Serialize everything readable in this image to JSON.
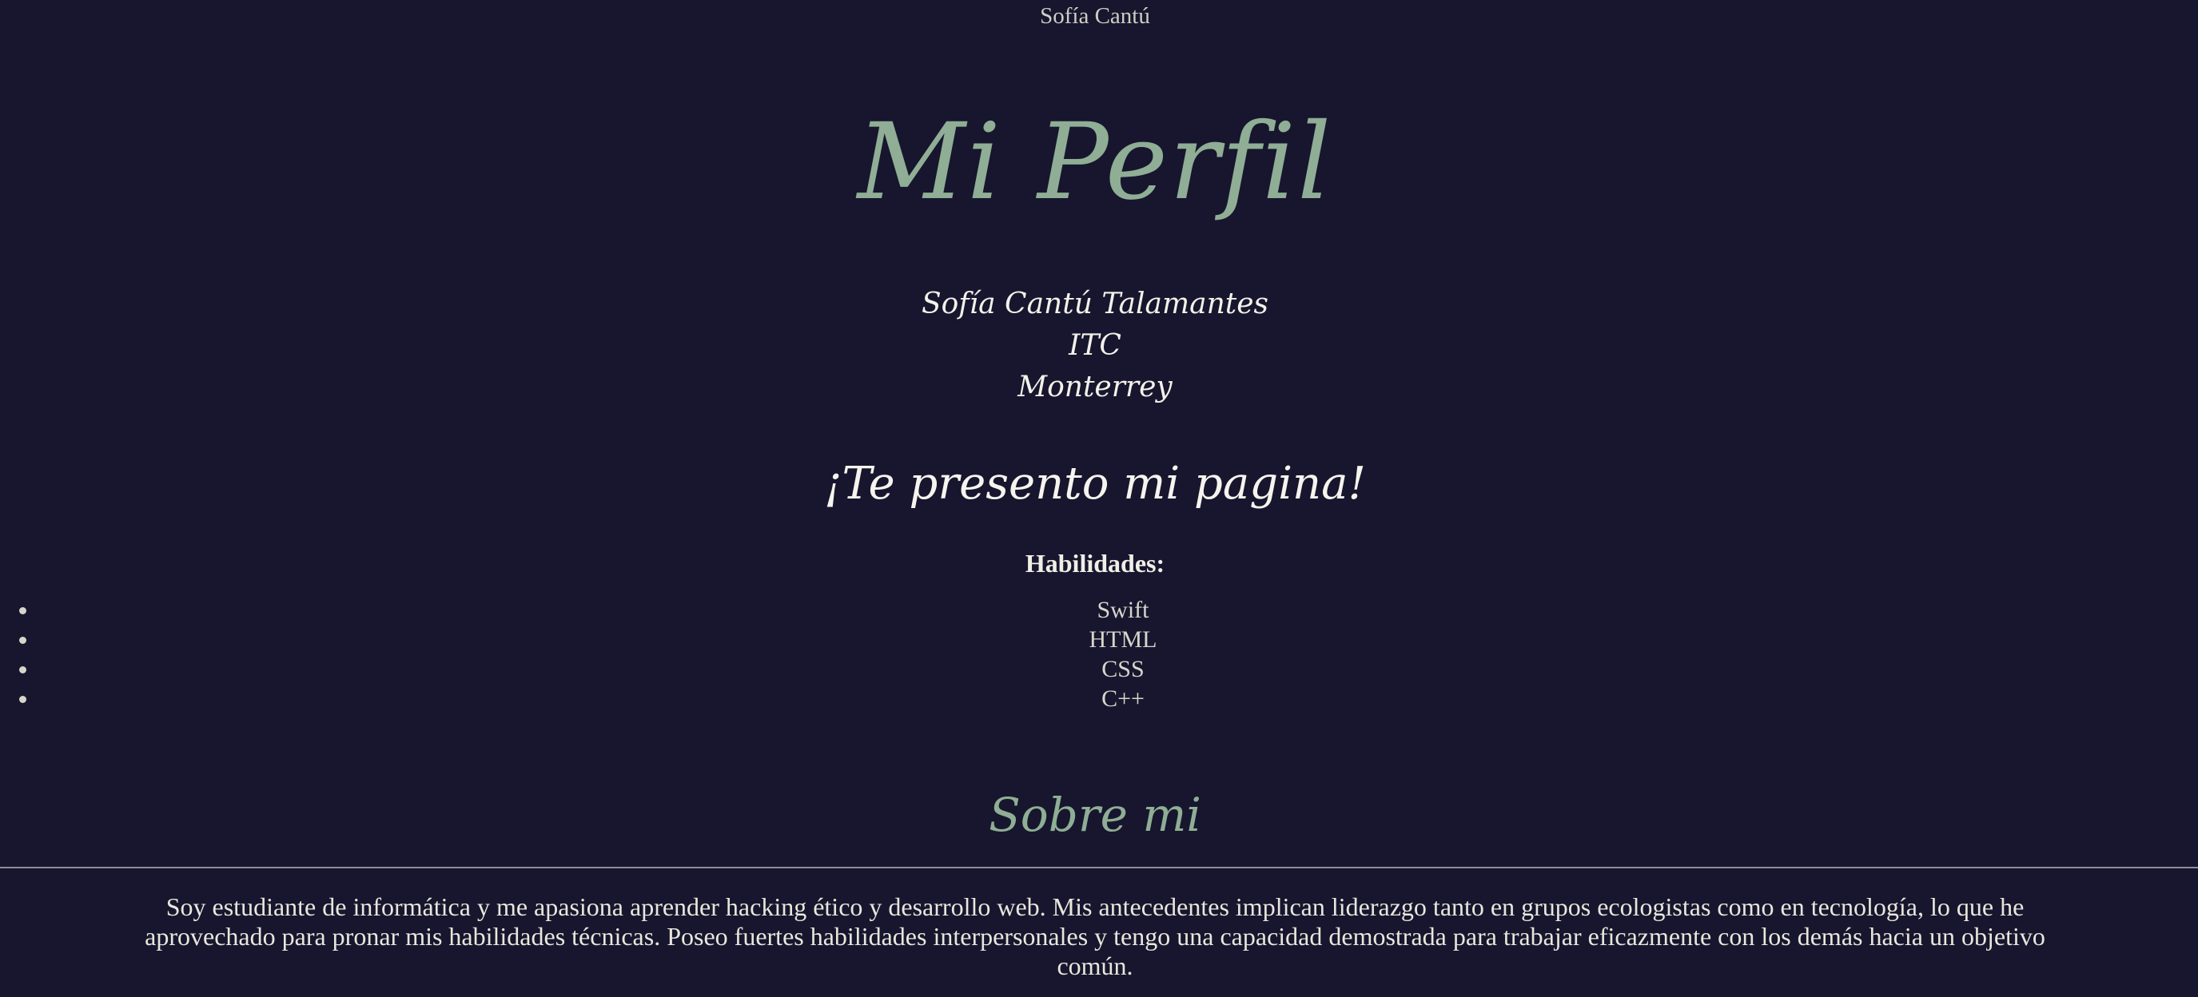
{
  "header": {
    "author": "Sofía Cantú"
  },
  "title": "Mi Perfil",
  "info": {
    "name": "Sofía Cantú Talamantes",
    "career": "ITC",
    "city": "Monterrey"
  },
  "intro": {
    "heading": "¡Te presento mi pagina!"
  },
  "skills": {
    "heading": "Habilidades:",
    "items": [
      "Swift",
      "HTML",
      "CSS",
      "C++"
    ]
  },
  "about": {
    "heading": "Sobre mi",
    "text": "Soy estudiante de informática y me apasiona aprender hacking ético y desarrollo web. Mis antecedentes implican liderazgo tanto en grupos ecologistas como en tecnología, lo que he aprovechado para pronar mis habilidades técnicas. Poseo fuertes habilidades interpersonales y tengo una capacidad demostrada para trabajar eficazmente con los demás hacia un objetivo común."
  },
  "colors": {
    "background": "#17162e",
    "accent_green": "#8fae95",
    "text_light": "#e9e6dc",
    "divider": "#8f8e99"
  }
}
